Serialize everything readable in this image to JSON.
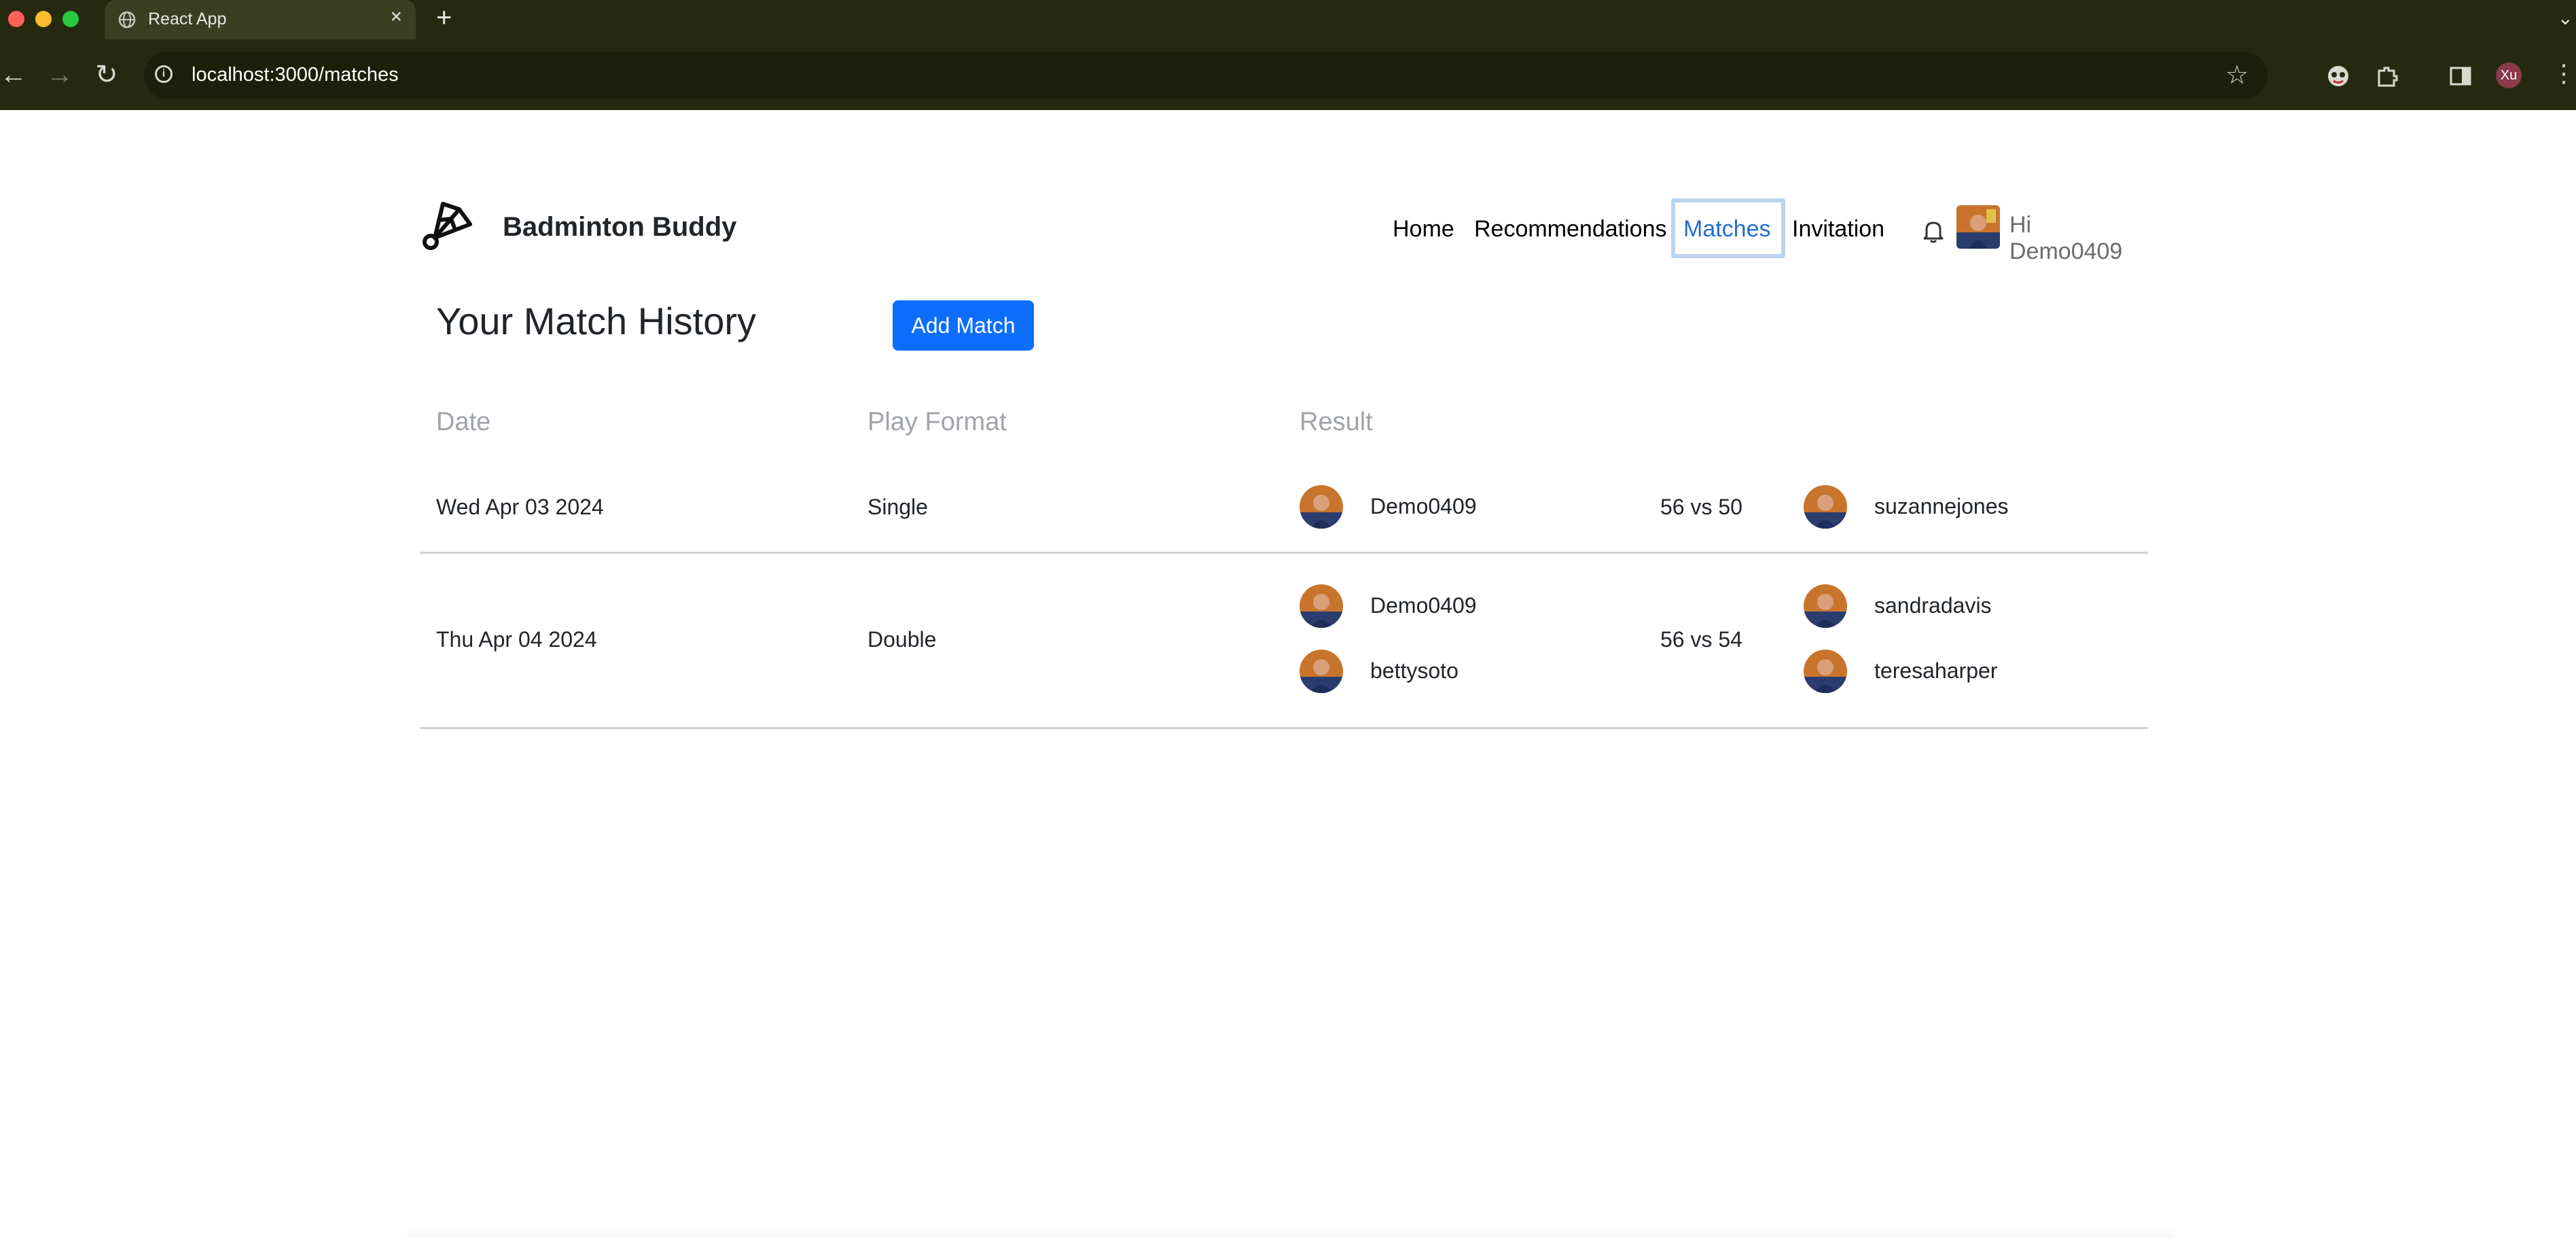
{
  "browser": {
    "tab_title": "React App",
    "close_glyph": "×",
    "new_tab_glyph": "+",
    "tab_search_glyph": "⌄",
    "url": "localhost:3000/matches",
    "back_glyph": "←",
    "forward_glyph": "→",
    "reload_glyph": "↻",
    "bookmark_glyph": "☆",
    "profile_initials": "Xu",
    "menu_glyph": "⋮",
    "icons": [
      "globe-icon",
      "info-icon",
      "star-icon",
      "extension-icon",
      "puzzle-icon",
      "sidebar-icon",
      "profile-avatar"
    ]
  },
  "app": {
    "brand_name": "Badminton Buddy",
    "nav": {
      "home": "Home",
      "recommendations": "Recommendations",
      "matches": "Matches",
      "invitation": "Invitation"
    },
    "greeting": "Hi Demo0409",
    "active_nav": "Matches",
    "accent_color": "#0d6efd"
  },
  "page": {
    "title": "Your Match History",
    "add_button": "Add Match",
    "columns": {
      "date": "Date",
      "format": "Play Format",
      "result": "Result"
    }
  },
  "matches": [
    {
      "date": "Wed Apr 03 2024",
      "format": "Single",
      "team1": [
        "Demo0409"
      ],
      "score": "56 vs 50",
      "team2": [
        "suzannejones"
      ]
    },
    {
      "date": "Thu Apr 04 2024",
      "format": "Double",
      "team1": [
        "Demo0409",
        "bettysoto"
      ],
      "score": "56 vs 54",
      "team2": [
        "sandradavis",
        "teresaharper"
      ]
    }
  ]
}
